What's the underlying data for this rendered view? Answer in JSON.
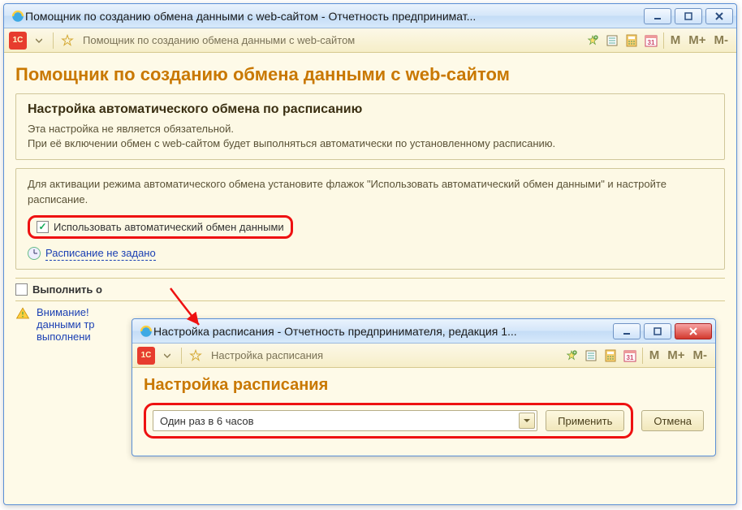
{
  "mainWindow": {
    "title": "Помощник по созданию обмена данными с web-сайтом - Отчетность предпринимат...",
    "toolbarTitle": "Помощник по созданию обмена данными с web-сайтом",
    "heading": "Помощник по созданию обмена данными с web-сайтом",
    "section": {
      "heading": "Настройка автоматического обмена по расписанию",
      "line1": "Эта настройка не является обязательной.",
      "line2": "При её включении обмен с web-сайтом будет выполняться автоматически по установленному расписанию."
    },
    "activation": {
      "instruction": "Для активации режима автоматического обмена установите флажок \"Использовать автоматический обмен данными\" и настройте расписание.",
      "checkboxLabel": "Использовать автоматический обмен данными",
      "checkboxChecked": true,
      "scheduleLink": "Расписание не задано"
    },
    "executeLabel": "Выполнить о",
    "warning": {
      "line1": "Внимание! ",
      "line2": "данными тр",
      "line3": "выполнени"
    }
  },
  "subWindow": {
    "title": "Настройка расписания - Отчетность предпринимателя, редакция 1...",
    "toolbarTitle": "Настройка расписания",
    "heading": "Настройка расписания",
    "dropdownValue": "Один раз в 6 часов",
    "applyBtn": "Применить",
    "cancelBtn": "Отмена"
  },
  "toolbarM": {
    "m": "М",
    "mplus": "М+",
    "mminus": "М-"
  }
}
